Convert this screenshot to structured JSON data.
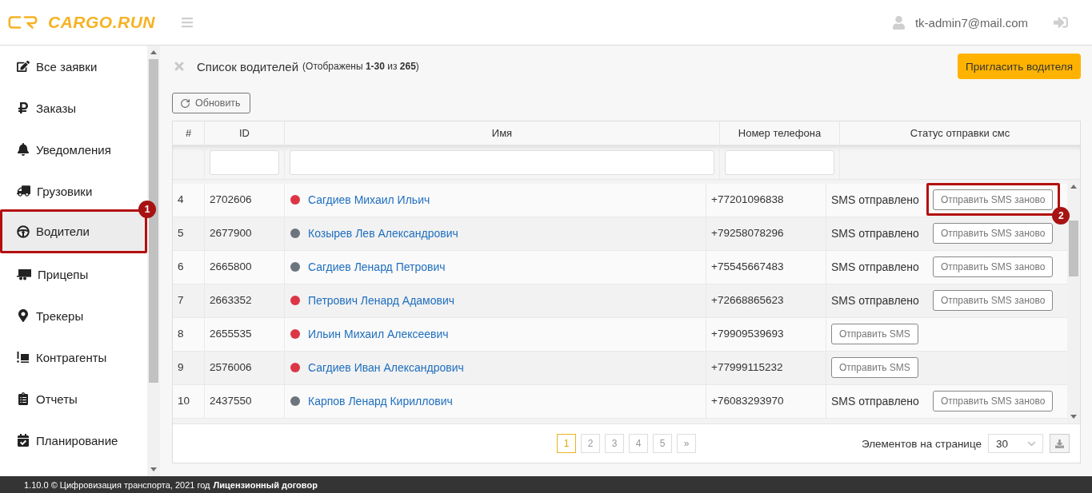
{
  "header": {
    "logo": "CARGO.RUN",
    "user_email": "tk-admin7@mail.com"
  },
  "sidebar": {
    "items": [
      {
        "label": "Все заявки",
        "selected": false
      },
      {
        "label": "Заказы",
        "selected": false
      },
      {
        "label": "Уведомления",
        "selected": false
      },
      {
        "label": "Грузовики",
        "selected": false
      },
      {
        "label": "Водители",
        "selected": true,
        "callout": "1"
      },
      {
        "label": "Прицепы",
        "selected": false
      },
      {
        "label": "Трекеры",
        "selected": false
      },
      {
        "label": "Контрагенты",
        "selected": false
      },
      {
        "label": "Отчеты",
        "selected": false
      },
      {
        "label": "Планирование",
        "selected": false
      }
    ]
  },
  "page": {
    "title": "Список водителей",
    "subtitle": "(Отображены **1-30** из **265**)",
    "invite_button": "Пригласить водителя",
    "refresh_button": "Обновить"
  },
  "table": {
    "columns": [
      "#",
      "ID",
      "Имя",
      "Номер телефона",
      "Статус отправки смс"
    ],
    "rows": [
      {
        "number": "4",
        "id": "2702606",
        "color": "#dc3545",
        "name": "Сагдиев Михаил Ильич",
        "phone": "+77201096838",
        "sms_status": "SMS отправлено",
        "action": "Отправить SMS заново",
        "callout": "2"
      },
      {
        "number": "5",
        "id": "2677900",
        "color": "#6c757d",
        "name": "Козырев Лев Александрович",
        "phone": "+79258078296",
        "sms_status": "SMS отправлено",
        "action": "Отправить SMS заново"
      },
      {
        "number": "6",
        "id": "2665800",
        "color": "#6c757d",
        "name": "Сагдиев Ленард Петрович",
        "phone": "+75545667483",
        "sms_status": "SMS отправлено",
        "action": "Отправить SMS заново"
      },
      {
        "number": "7",
        "id": "2663352",
        "color": "#dc3545",
        "name": "Петрович Ленард Адамович",
        "phone": "+72668865623",
        "sms_status": "SMS отправлено",
        "action": "Отправить SMS заново"
      },
      {
        "number": "8",
        "id": "2655535",
        "color": "#dc3545",
        "name": "Ильин Михаил Алексеевич",
        "phone": "+79909539693",
        "action": "Отправить SMS"
      },
      {
        "number": "9",
        "id": "2576006",
        "color": "#dc3545",
        "name": "Сагдиев Иван Александрович",
        "phone": "+77999115232",
        "action": "Отправить SMS"
      },
      {
        "number": "10",
        "id": "2437550",
        "color": "#6c757d",
        "name": "Карпов Ленард Кириллович",
        "phone": "+76083293970",
        "sms_status": "SMS отправлено",
        "action": "Отправить SMS заново"
      }
    ]
  },
  "pagination": {
    "pages": [
      {
        "label": "1",
        "selected": true
      },
      {
        "label": "2",
        "selected": false
      },
      {
        "label": "3",
        "selected": false
      },
      {
        "label": "4",
        "selected": false
      },
      {
        "label": "5",
        "selected": false
      },
      {
        "label": "»",
        "selected": false
      }
    ],
    "per_page_label": "Элементов на странице",
    "per_page_value": "30"
  },
  "footer": {
    "text": "1.10.0 © Цифровизация транспорта, 2021 год",
    "link": "Лицензионный договор"
  }
}
